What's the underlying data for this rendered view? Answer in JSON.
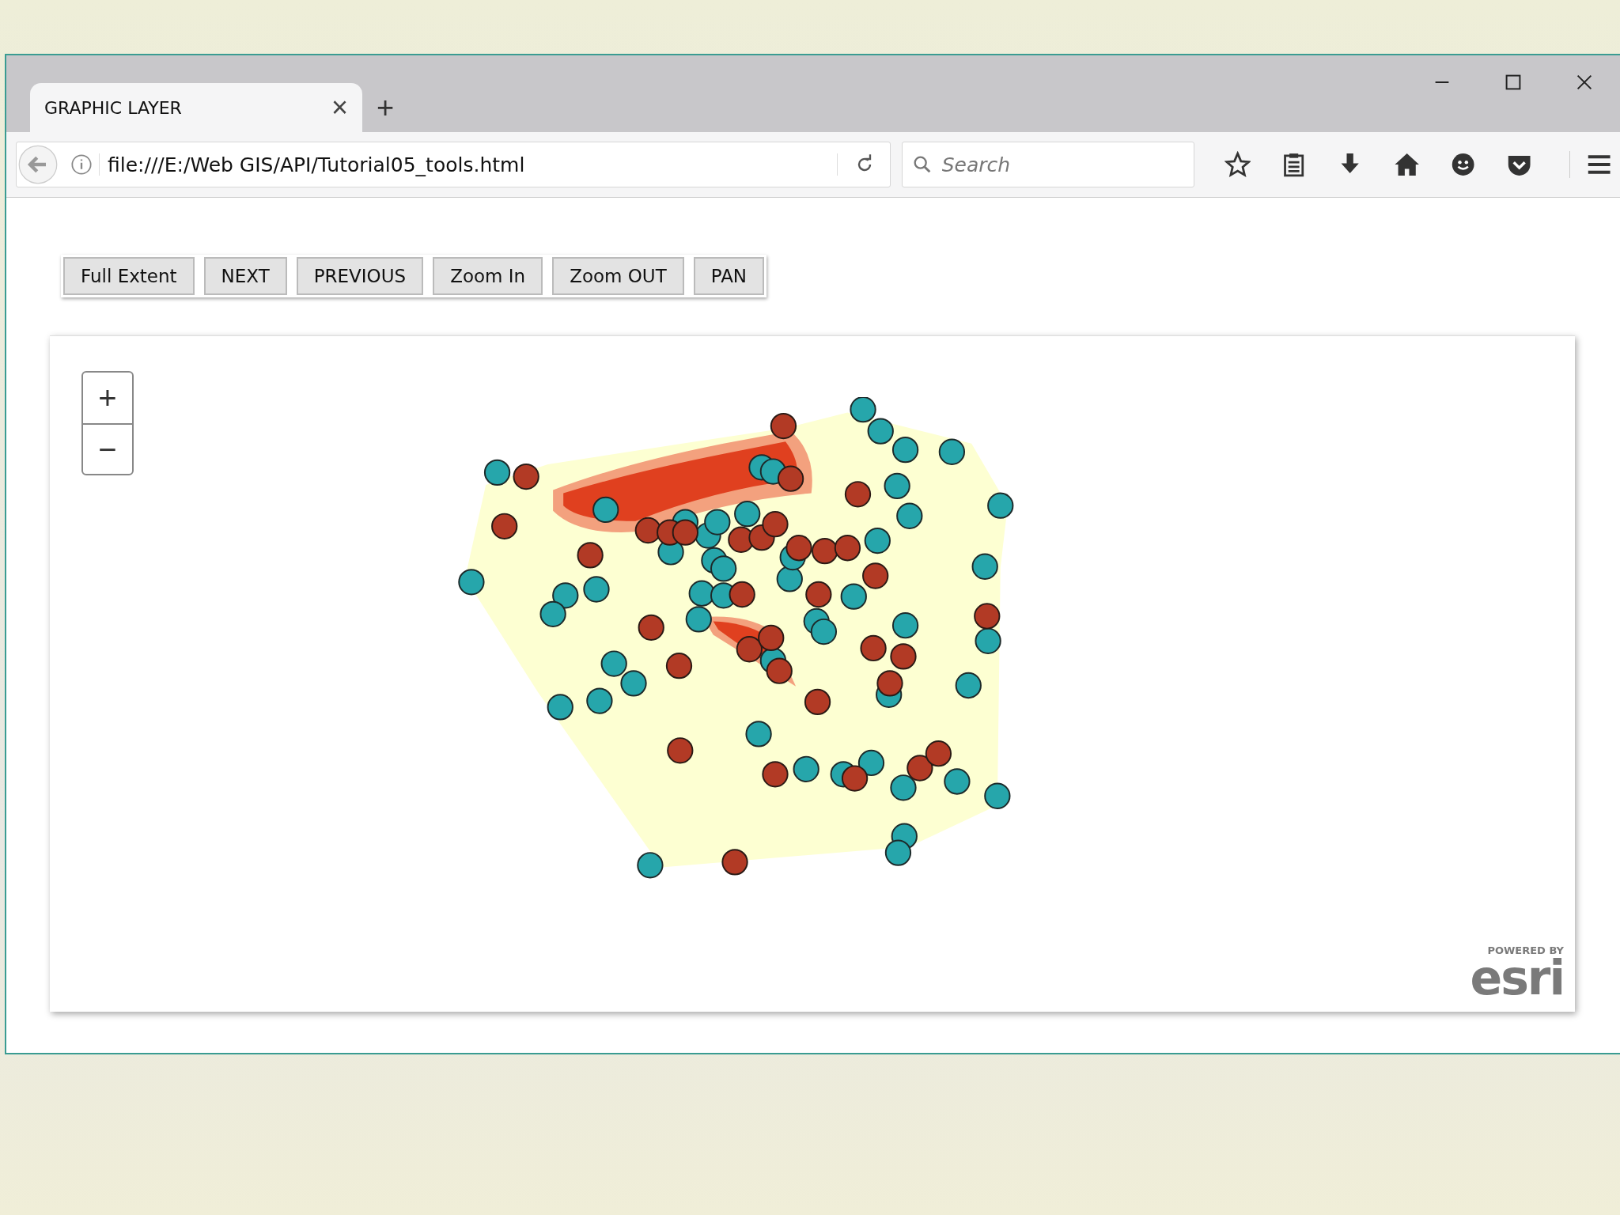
{
  "tab": {
    "title": "GRAPHIC LAYER",
    "close": "×",
    "new_tab": "+"
  },
  "address_bar": {
    "url": "file:///E:/Web GIS/API/Tutorial05_tools.html"
  },
  "search": {
    "placeholder": "Search"
  },
  "tool_buttons": [
    "Full Extent",
    "NEXT",
    "PREVIOUS",
    "Zoom In",
    "Zoom OUT",
    "PAN"
  ],
  "map": {
    "zoom_controls": [
      "+",
      "−"
    ],
    "attribution": {
      "caption": "POWERED BY",
      "logo": "esri"
    }
  }
}
